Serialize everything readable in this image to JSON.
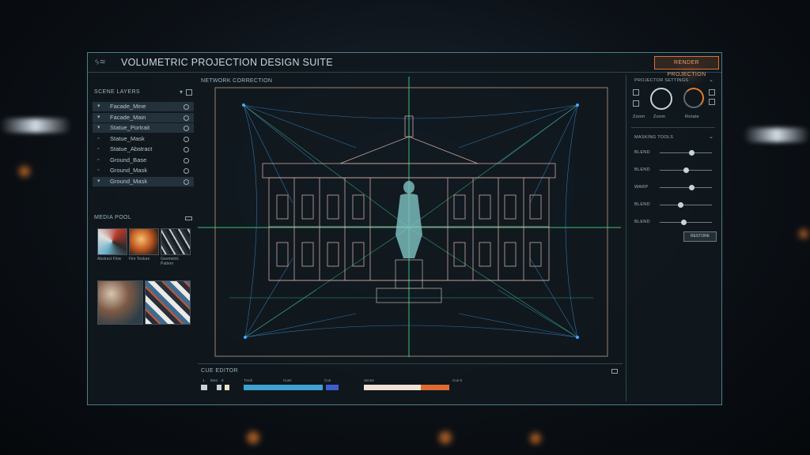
{
  "window": {
    "title": "VOLUMETRIC PROJECTION DESIGN SUITE",
    "render_button": "RENDER PROJECTION"
  },
  "layers_panel": {
    "title": "SCENE LAYERS",
    "items": [
      {
        "label": "Facade_Mine",
        "checked": true,
        "selected": true
      },
      {
        "label": "Facade_Main",
        "checked": true,
        "selected": true
      },
      {
        "label": "Statue_Portrait",
        "checked": true,
        "selected": true
      },
      {
        "label": "Statue_Mask",
        "checked": false,
        "selected": false
      },
      {
        "label": "Statue_Abstract",
        "checked": false,
        "selected": false
      },
      {
        "label": "Ground_Base",
        "checked": false,
        "selected": false
      },
      {
        "label": "Ground_Mask",
        "checked": false,
        "selected": false
      },
      {
        "label": "Ground_Mask",
        "checked": true,
        "selected": true
      }
    ]
  },
  "media_pool": {
    "title": "MEDIA POOL",
    "thumbs": [
      {
        "caption": "Abstract Flow"
      },
      {
        "caption": "Fire Texture"
      },
      {
        "caption": "Geometric Pattern"
      }
    ]
  },
  "canvas": {
    "title": "NETWORK CORRECTION"
  },
  "right_panel": {
    "header": "PROJECTOR SETTINGS",
    "dial1": "Zoom",
    "dial2": "Rotate",
    "section": "MASKING TOOLS",
    "sliders": [
      {
        "label": "BLEND",
        "value": 0.6
      },
      {
        "label": "BLEND",
        "value": 0.5
      },
      {
        "label": "WARP",
        "value": 0.6
      },
      {
        "label": "BLEND",
        "value": 0.4
      },
      {
        "label": "BLEND",
        "value": 0.45
      }
    ],
    "apply_button": "RESTORE"
  },
  "timeline": {
    "title": "CUE EDITOR",
    "labels": [
      "1",
      "Bars",
      "8",
      "Track",
      "Cues",
      "Cue",
      "Sector",
      "Cue 5"
    ],
    "segments_colors": [
      "#3ea2d3",
      "#3f5ecc",
      "#f0e2d6",
      "#e06b32"
    ]
  },
  "colors": {
    "accent": "#d0743a",
    "frame": "#4f7d86",
    "wire_green": "#3fbf7a",
    "wire_blue": "#3b8fd8"
  }
}
